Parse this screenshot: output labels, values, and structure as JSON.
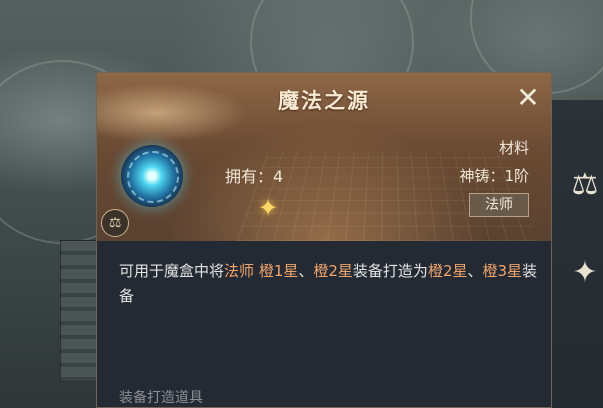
{
  "item": {
    "name": "魔法之源",
    "owned_label": "拥有：4",
    "category": "材料",
    "forge_level": "神铸：1阶",
    "class_badge": "法师",
    "description": {
      "segments": [
        {
          "text": "可用于魔盒中将",
          "highlight": false
        },
        {
          "text": "法师",
          "highlight": true
        },
        {
          "text": " ",
          "highlight": false
        },
        {
          "text": "橙1星",
          "highlight": true
        },
        {
          "text": "、",
          "highlight": false
        },
        {
          "text": "橙2星",
          "highlight": true
        },
        {
          "text": "装备打造为",
          "highlight": false
        },
        {
          "text": "橙2星",
          "highlight": true
        },
        {
          "text": "、",
          "highlight": false
        },
        {
          "text": "橙3星",
          "highlight": true
        },
        {
          "text": "装备",
          "highlight": false
        }
      ]
    },
    "footer_label": "装备打造道具"
  },
  "icons": {
    "close": "close-icon",
    "item": "magic-orb-icon",
    "sparkle": "sparkle-icon",
    "emblem": "scales-emblem-icon",
    "side_top": "scales-icon",
    "side_bottom": "feather-icon"
  },
  "colors": {
    "highlight": "#f0a46a",
    "text": "#e3e3e3",
    "card_bg": "#232a33"
  }
}
